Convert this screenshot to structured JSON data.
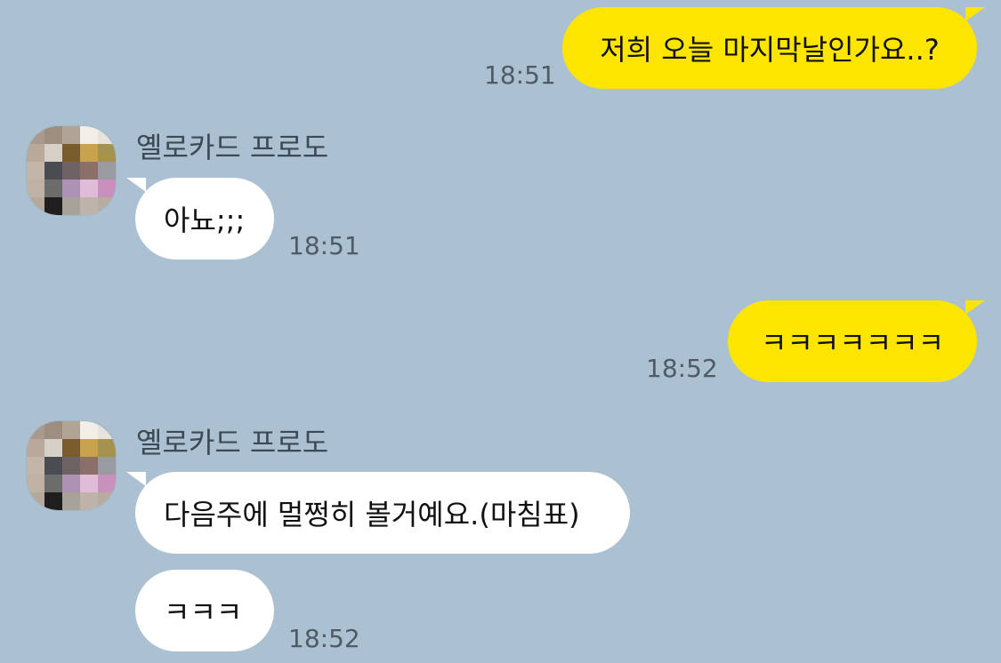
{
  "messages": [
    {
      "direction": "out",
      "text": "저희 오늘 마지막날인가요..?",
      "time": "18:51"
    },
    {
      "direction": "in",
      "sender": "옐로카드 프로도",
      "text": "아뇨;;;",
      "time": "18:51"
    },
    {
      "direction": "out",
      "text": "ㅋㅋㅋㅋㅋㅋㅋ",
      "time": "18:52"
    },
    {
      "direction": "in",
      "sender": "옐로카드 프로도",
      "text": "다음주에 멀쩡히 볼거예요.(마침표)"
    },
    {
      "direction": "in",
      "text": "ㅋㅋㅋ",
      "time": "18:52"
    }
  ],
  "colors": {
    "background": "#abc1d1",
    "outgoing_bubble": "#fee500",
    "incoming_bubble": "#ffffff",
    "time_text": "#4e5b66",
    "sender_text": "#3d4a55"
  },
  "avatar_icon": "pixelated-profile-avatar-icon"
}
